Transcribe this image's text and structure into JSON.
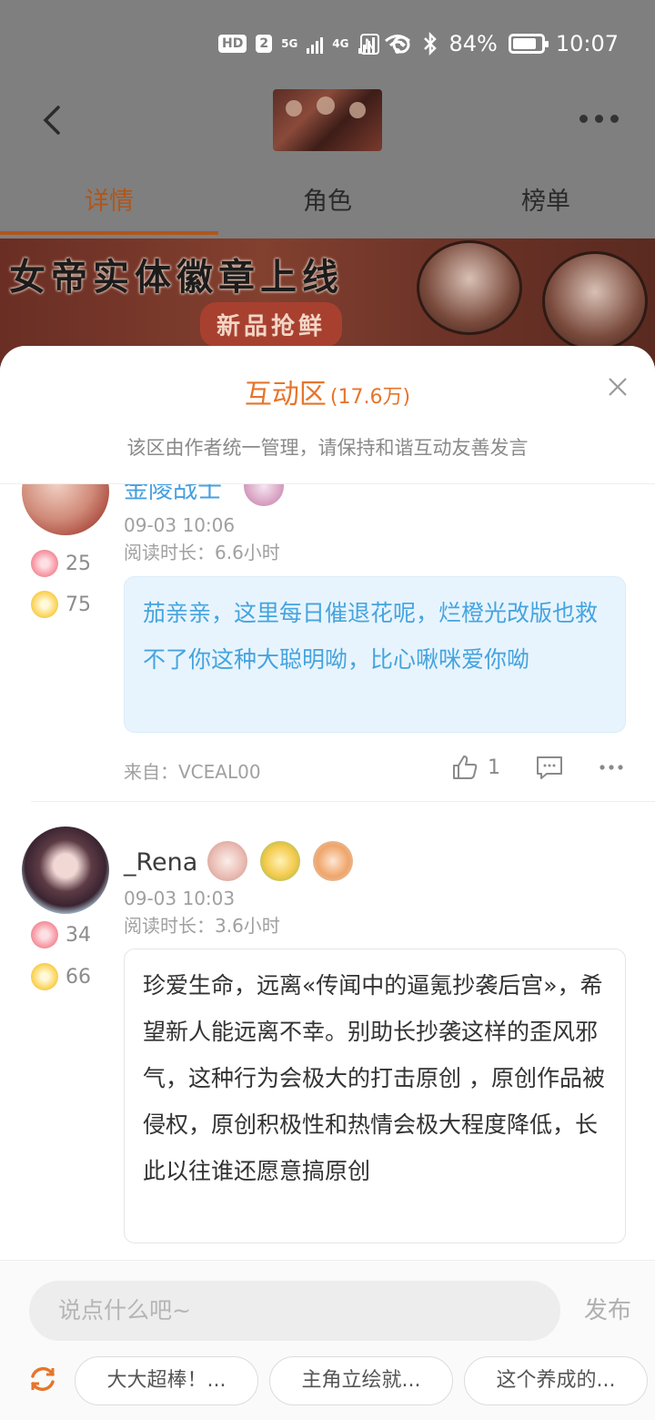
{
  "status_bar": {
    "hd": "HD",
    "sim": "2",
    "net1": "5G",
    "net2": "4G",
    "nfc": "N",
    "battery": "84%",
    "battery_level": 0.84,
    "time": "10:07"
  },
  "nav": {
    "tabs": [
      {
        "label": "详情",
        "active": true
      },
      {
        "label": "角色",
        "active": false
      },
      {
        "label": "榜单",
        "active": false
      }
    ]
  },
  "banner": {
    "title": "女帝实体徽章上线",
    "tag": "新品抢鲜"
  },
  "sheet": {
    "title": "互动区",
    "count": "(17.6万)",
    "subtitle": "该区由作者统一管理，请保持和谐互动友善发言"
  },
  "posts": [
    {
      "username": "金陵战士",
      "time": "09-03 10:06",
      "read_time": "阅读时长：6.6小时",
      "pink_count": "25",
      "yellow_count": "75",
      "content": "茄亲亲，这里每日催退花呢，烂橙光改版也救不了你这种大聪明呦，比心啾咪爱你呦",
      "from": "来自：VCEAL00",
      "likes": "1"
    },
    {
      "username": "_Rena",
      "time": "09-03 10:03",
      "read_time": "阅读时长：3.6小时",
      "pink_count": "34",
      "yellow_count": "66",
      "content": "珍爱生命，远离«传闻中的逼氪抄袭后宫»，希望新人能远离不幸。别助长抄袭这样的歪风邪气，这种行为会极大的打击原创 ，原创作品被侵权，原创积极性和热情会极大程度降低，长此以往谁还愿意搞原创"
    }
  ],
  "composer": {
    "placeholder": "说点什么吧~",
    "publish": "发布",
    "suggestions": [
      "大大超棒！...",
      "主角立绘就...",
      "这个养成的..."
    ]
  },
  "colors": {
    "accent": "#e6752b",
    "tab_active": "#b0561a",
    "link_blue": "#46a0e0",
    "bubble_blue_bg": "#e8f4fd"
  }
}
